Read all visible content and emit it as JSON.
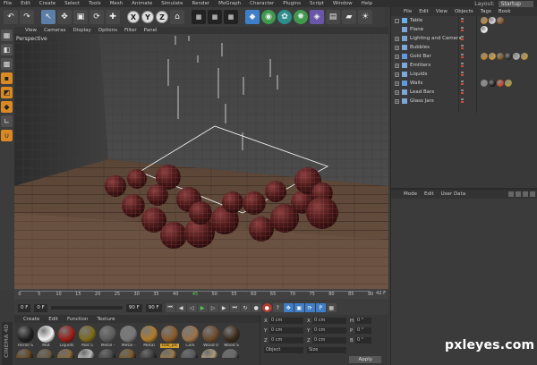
{
  "menubar": {
    "items": [
      "File",
      "Edit",
      "Create",
      "Select",
      "Tools",
      "Mesh",
      "Animate",
      "Simulate",
      "Render",
      "MoGraph",
      "Character",
      "Plugins",
      "Script",
      "Window",
      "Help"
    ],
    "layout_label": "Layout:",
    "layout_value": "Startup"
  },
  "toolbar": {
    "axis_labels": [
      "X",
      "Y",
      "Z"
    ]
  },
  "viewport": {
    "menu": [
      "View",
      "Cameras",
      "Display",
      "Options",
      "Filter",
      "Panel"
    ],
    "label": "Perspective"
  },
  "timeline": {
    "ticks": [
      "0",
      "5",
      "10",
      "15",
      "20",
      "25",
      "30",
      "35",
      "40",
      "45",
      "50",
      "55",
      "60",
      "65",
      "70",
      "75",
      "80",
      "85",
      "90"
    ],
    "current_frame": "45",
    "end_label": "42 F"
  },
  "transport": {
    "start_field": "0 F",
    "min_field": "0 F",
    "max_field": "90 F",
    "slider_position": 0.0
  },
  "materials": {
    "menu": [
      "Create",
      "Edit",
      "Function",
      "Texture"
    ],
    "items": [
      {
        "name": "Reroll S",
        "color": "#1f1f1f"
      },
      {
        "name": "Mat",
        "color": "#f2f2f2"
      },
      {
        "name": "Liquids",
        "color": "#9b1c15"
      },
      {
        "name": "Mat.5",
        "color": "#7a6a1a"
      },
      {
        "name": "Metal -",
        "color": "#5a5a5a"
      },
      {
        "name": "Metal -",
        "color": "#777777"
      },
      {
        "name": "Metal",
        "color": "#b07a2a"
      },
      {
        "name": "Oak_plc",
        "color": "#8a5a2a"
      },
      {
        "name": "Cork",
        "color": "#9a7248"
      },
      {
        "name": "Wood 0",
        "color": "#6a4a2a"
      },
      {
        "name": "Wood S",
        "color": "#3a2a1a"
      }
    ],
    "row2_colors": [
      "#6a4a22",
      "#6a5a42",
      "#8a6a3a",
      "#b8b8b8",
      "#4a4a4a",
      "#7a5a2a",
      "#3e3e3e",
      "#9a7a4a",
      "#5a5a5a",
      "#aa9a7a",
      "#6a6a6a"
    ]
  },
  "coords": {
    "rows": [
      {
        "a": "X",
        "v1": "0 cm",
        "b": "X",
        "v2": "0 cm",
        "c": "H",
        "v3": "0 °"
      },
      {
        "a": "Y",
        "v1": "0 cm",
        "b": "Y",
        "v2": "0 cm",
        "c": "P",
        "v3": "0 °"
      },
      {
        "a": "Z",
        "v1": "0 cm",
        "b": "Z",
        "v2": "0 cm",
        "c": "B",
        "v3": "0 °"
      }
    ],
    "mode_1": "Object",
    "mode_2": "Size",
    "apply": "Apply"
  },
  "object_manager": {
    "menu": [
      "File",
      "Edit",
      "View",
      "Objects",
      "Tags",
      "Book"
    ],
    "objects": [
      {
        "name": "Table",
        "expander": "-",
        "icon_color": "#6ab0e8",
        "tag_colors": [
          "#c48a40",
          "#d9d9d9",
          "#8a5a2a"
        ]
      },
      {
        "name": "Plane",
        "expander": "",
        "icon_color": "#7da6d9",
        "tag_colors": [
          "#f5f5f5"
        ]
      },
      {
        "name": "Lighting and Camera",
        "expander": "+",
        "icon_color": "#7aa3d0",
        "tag_colors": []
      },
      {
        "name": "Bubbles",
        "expander": "+",
        "icon_color": "#7da6d9",
        "tag_colors": []
      },
      {
        "name": "Gold Bar",
        "expander": "+",
        "icon_color": "#5f9adf",
        "tag_colors": [
          "#c08a30",
          "#d2a040",
          "#7a5a2a",
          "#2a2a2a",
          "#b0b0b0",
          "#c89a40"
        ]
      },
      {
        "name": "Emitters",
        "expander": "+",
        "icon_color": "#7da6d9",
        "tag_colors": []
      },
      {
        "name": "Liquids",
        "expander": "+",
        "icon_color": "#7da6d9",
        "tag_colors": []
      },
      {
        "name": "Walls",
        "expander": "+",
        "icon_color": "#5f9adf",
        "tag_colors": [
          "#8a8a8a",
          "#1c1c1c",
          "#c84a30",
          "#b0a040"
        ]
      },
      {
        "name": "Lead Bars",
        "expander": "+",
        "icon_color": "#7da6d9",
        "tag_colors": []
      },
      {
        "name": "Glass Jars",
        "expander": "+",
        "icon_color": "#7da6d9",
        "tag_colors": []
      }
    ]
  },
  "attribute_manager": {
    "menu": [
      "Mode",
      "Edit",
      "User Data"
    ]
  },
  "branding": {
    "app": "CINEMA 4D"
  },
  "watermark": "pxleyes.com"
}
